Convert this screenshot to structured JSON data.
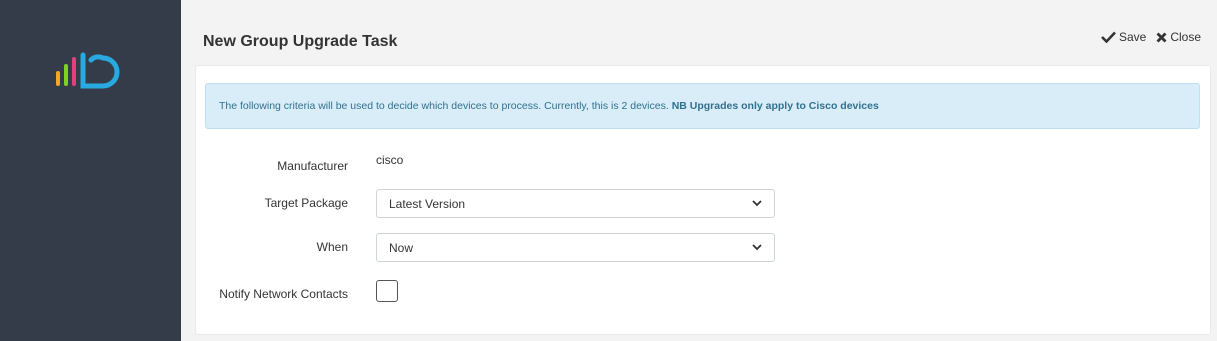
{
  "page": {
    "title": "New Group Upgrade Task"
  },
  "toolbar": {
    "save_label": "Save",
    "close_label": "Close"
  },
  "alert": {
    "text_prefix": "The following criteria will be used to decide which devices to process. Currently, this is ",
    "device_count": "2",
    "text_suffix": " devices. ",
    "note": "NB Upgrades only apply to Cisco devices"
  },
  "form": {
    "manufacturer": {
      "label": "Manufacturer",
      "value": "cisco"
    },
    "target_package": {
      "label": "Target Package",
      "selected": "Latest Version"
    },
    "when": {
      "label": "When",
      "selected": "Now"
    },
    "notify": {
      "label": "Notify Network Contacts",
      "checked": false
    }
  },
  "colors": {
    "sidebar": "#343c49",
    "alert_bg": "#d8edf7",
    "alert_text": "#31708f",
    "logo_orange": "#f5a623",
    "logo_green": "#7ed321",
    "logo_pink": "#e0407b",
    "logo_blue": "#29a9e1"
  },
  "icons": {
    "save": "check-icon",
    "close": "x-icon",
    "select": "chevron-down-icon"
  }
}
